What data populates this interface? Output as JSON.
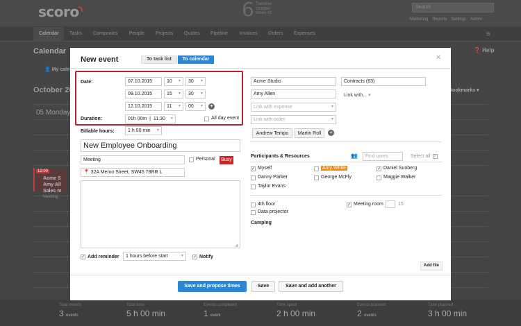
{
  "app": {
    "logo": "scoro"
  },
  "header": {
    "date_day": "6",
    "date_lines": [
      "Tuesday",
      "October",
      "Week 41"
    ],
    "search_placeholder": "Search",
    "links": [
      "Marketing",
      "Reports",
      "Settings",
      "Admin"
    ]
  },
  "nav": {
    "items": [
      "Calendar",
      "Tasks",
      "Companies",
      "People",
      "Projects",
      "Quotes",
      "Pipeline",
      "Invoices",
      "Orders",
      "Expenses"
    ]
  },
  "background": {
    "page_title": "Calendar",
    "help": "Help",
    "my_calendar": "My calend",
    "month": "October 20",
    "day": "05 Monday",
    "bookmarks": "Bookmarks",
    "event_time": "12:00",
    "event_lines": [
      "Acme S",
      "Amy All",
      "Sales m",
      "Meeting"
    ],
    "stats": [
      {
        "label": "Total events",
        "value": "3",
        "unit": "events"
      },
      {
        "label": "Total time",
        "value": "5 h 00 min",
        "unit": ""
      },
      {
        "label": "Events completed",
        "value": "1",
        "unit": "event"
      },
      {
        "label": "Time spent",
        "value": "2 h 00 min",
        "unit": ""
      },
      {
        "label": "Events planned",
        "value": "2",
        "unit": "events"
      },
      {
        "label": "Time planned",
        "value": "3 h 00 min",
        "unit": ""
      }
    ]
  },
  "modal": {
    "title": "New event",
    "tab_task_list": "To task list",
    "tab_to_calendar": "To calendar",
    "date_label": "Date:",
    "dates": [
      {
        "date": "07.10.2015",
        "hour": "10",
        "minute": "30"
      },
      {
        "date": "09.10.2015",
        "hour": "15",
        "minute": "30"
      },
      {
        "date": "12.10.2015",
        "hour": "11",
        "minute": "00"
      }
    ],
    "duration_label": "Duration:",
    "duration_value": "01h 00m",
    "duration_time": "11:30",
    "all_day": "All day event",
    "billable_label": "Billable hours:",
    "billable_value": "1 h 00 min",
    "event_title": "New Employee Onboarding",
    "event_type": "Meeting",
    "personal": "Personal",
    "busy": "Busy",
    "location": "32A Memo Street, SW45 78RR L",
    "add_reminder": "Add reminder",
    "reminder_value": "1 hours before start",
    "notify": "Notify",
    "company": "Acme Studio",
    "contract": "Contracts (63)",
    "contact": "Amy Allen",
    "link_with": "Link with...",
    "link_expense": "Link with expense",
    "link_order": "Link with order",
    "people_buttons": [
      "Andrew Tempo",
      "Martin Roll"
    ],
    "participants_title": "Participants & Resources",
    "find_users": "Find users",
    "select_all": "Select all",
    "participants": [
      {
        "name": "Myself",
        "checked": true
      },
      {
        "name": "Amy White",
        "checked": false
      },
      {
        "name": "Daniel Sunberg",
        "checked": true
      },
      {
        "name": "Danny Parker",
        "checked": false
      },
      {
        "name": "George McFly",
        "checked": false
      },
      {
        "name": "Maggie Walker",
        "checked": false
      },
      {
        "name": "Taylor Evans",
        "checked": false
      }
    ],
    "resources": [
      {
        "name": "4th floor",
        "checked": false
      },
      {
        "name": "Meeting room",
        "checked": true,
        "qty": "15"
      },
      {
        "name": "Data projector",
        "checked": false
      }
    ],
    "camping": "Camping",
    "add_file": "Add file",
    "btn_propose": "Save and propose times",
    "btn_save": "Save",
    "btn_save_add": "Save and add another"
  },
  "colors": {
    "accent": "#2a86d6",
    "highlight": "#b8242e",
    "busy": "#c9272b",
    "amy": "#f18a1d"
  }
}
